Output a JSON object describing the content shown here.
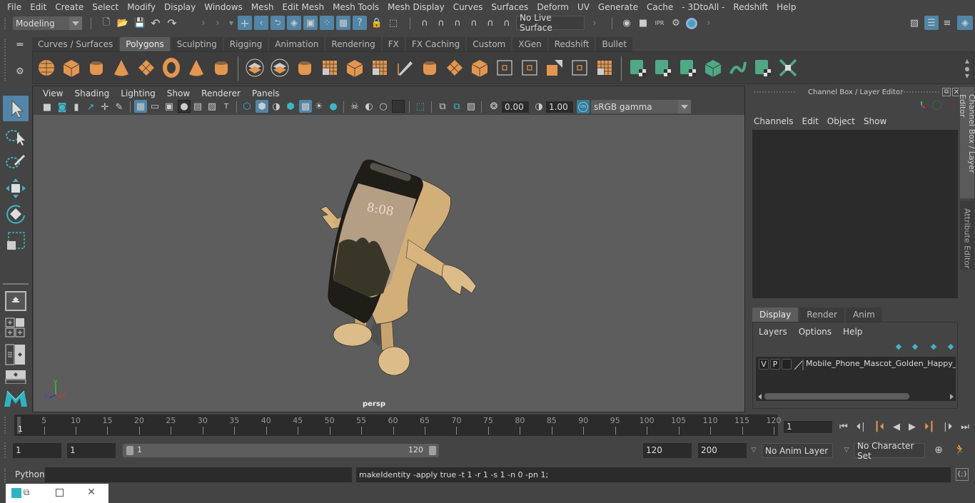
{
  "menubar": {
    "items": [
      "File",
      "Edit",
      "Create",
      "Select",
      "Modify",
      "Display",
      "Windows",
      "Mesh",
      "Edit Mesh",
      "Mesh Tools",
      "Mesh Display",
      "Curves",
      "Surfaces",
      "Deform",
      "UV",
      "Generate",
      "Cache",
      "- 3DtoAll -",
      "Redshift",
      "Help"
    ]
  },
  "statusline": {
    "workspace": "Modeling",
    "live_surface": "No Live Surface"
  },
  "shelf": {
    "tabs": [
      "Curves / Surfaces",
      "Polygons",
      "Sculpting",
      "Rigging",
      "Animation",
      "Rendering",
      "FX",
      "FX Caching",
      "Custom",
      "XGen",
      "Redshift",
      "Bullet"
    ],
    "active_tab": "Polygons"
  },
  "viewport": {
    "menu": [
      "View",
      "Shading",
      "Lighting",
      "Show",
      "Renderer",
      "Panels"
    ],
    "exposure": "0.00",
    "gamma": "1.00",
    "color_mgmt_toggle": "ON",
    "color_space": "sRGB gamma",
    "camera_label": "persp",
    "screen_clock": "8:08",
    "axis": {
      "x": "x",
      "y": "y",
      "z": "z"
    }
  },
  "channel_box": {
    "title": "Channel Box / Layer Editor",
    "menu": [
      "Channels",
      "Edit",
      "Object",
      "Show"
    ]
  },
  "layer_editor": {
    "tabs": [
      "Display",
      "Render",
      "Anim"
    ],
    "active_tab": "Display",
    "menu": [
      "Layers",
      "Options",
      "Help"
    ],
    "layers": [
      {
        "v": "V",
        "p": "P",
        "name": "Mobile_Phone_Mascot_Golden_Happy_Po"
      }
    ]
  },
  "side_tabs": [
    "Channel Box / Layer Editor",
    "Attribute Editor"
  ],
  "timeline": {
    "ticks": [
      5,
      10,
      15,
      20,
      25,
      30,
      35,
      40,
      45,
      50,
      55,
      60,
      65,
      70,
      75,
      80,
      85,
      90,
      95,
      100,
      105,
      110,
      115,
      120
    ],
    "start_frame": 1,
    "max_frame": 120,
    "current_frame": "1",
    "current_frame_marker": "1"
  },
  "range": {
    "start": "1",
    "playback_start": "1",
    "slider_start": "1",
    "slider_end": "120",
    "playback_end": "120",
    "end": "200",
    "anim_layer": "No Anim Layer",
    "character_set": "No Character Set"
  },
  "command": {
    "language": "Python",
    "input": "",
    "result": "makeIdentity -apply true -t 1 -r 1 -s 1 -n 0 -pn 1;"
  },
  "colors": {
    "accent_blue": "#5285a6",
    "shelf_orange": "#e3964f",
    "shelf_green": "#4fa984",
    "teal": "#2eb4c0"
  }
}
